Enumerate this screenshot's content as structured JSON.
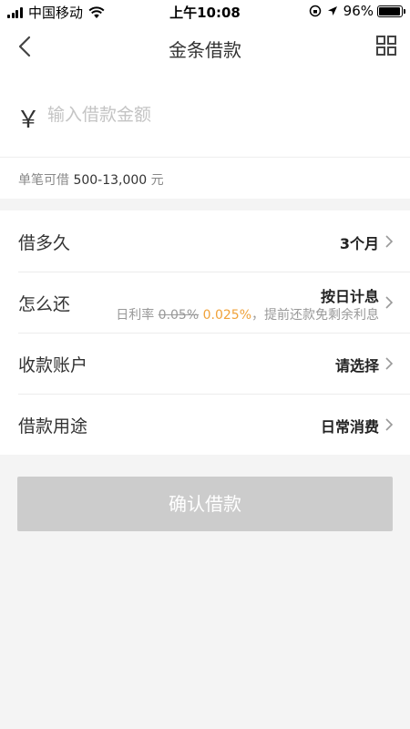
{
  "status_bar": {
    "carrier": "中国移动",
    "time": "上午10:08",
    "battery": "96%"
  },
  "nav": {
    "title": "金条借款"
  },
  "amount": {
    "currency_symbol": "￥",
    "placeholder": "输入借款金额",
    "limit_label": "单笔可借",
    "limit_range": "500-13,000",
    "limit_unit": "元"
  },
  "options": {
    "duration": {
      "label": "借多久",
      "value": "3个月"
    },
    "repay": {
      "label": "怎么还",
      "value": "按日计息",
      "rate_label": "日利率",
      "rate_old": "0.05%",
      "rate_new": "0.025%",
      "rate_note": "，提前还款免剩余利息"
    },
    "account": {
      "label": "收款账户",
      "value": "请选择"
    },
    "purpose": {
      "label": "借款用途",
      "value": "日常消费"
    }
  },
  "confirm_button": {
    "label": "确认借款"
  },
  "colors": {
    "accent_rate": "#f0a23a",
    "button_disabled": "#cccccc",
    "background": "#f4f4f4"
  }
}
